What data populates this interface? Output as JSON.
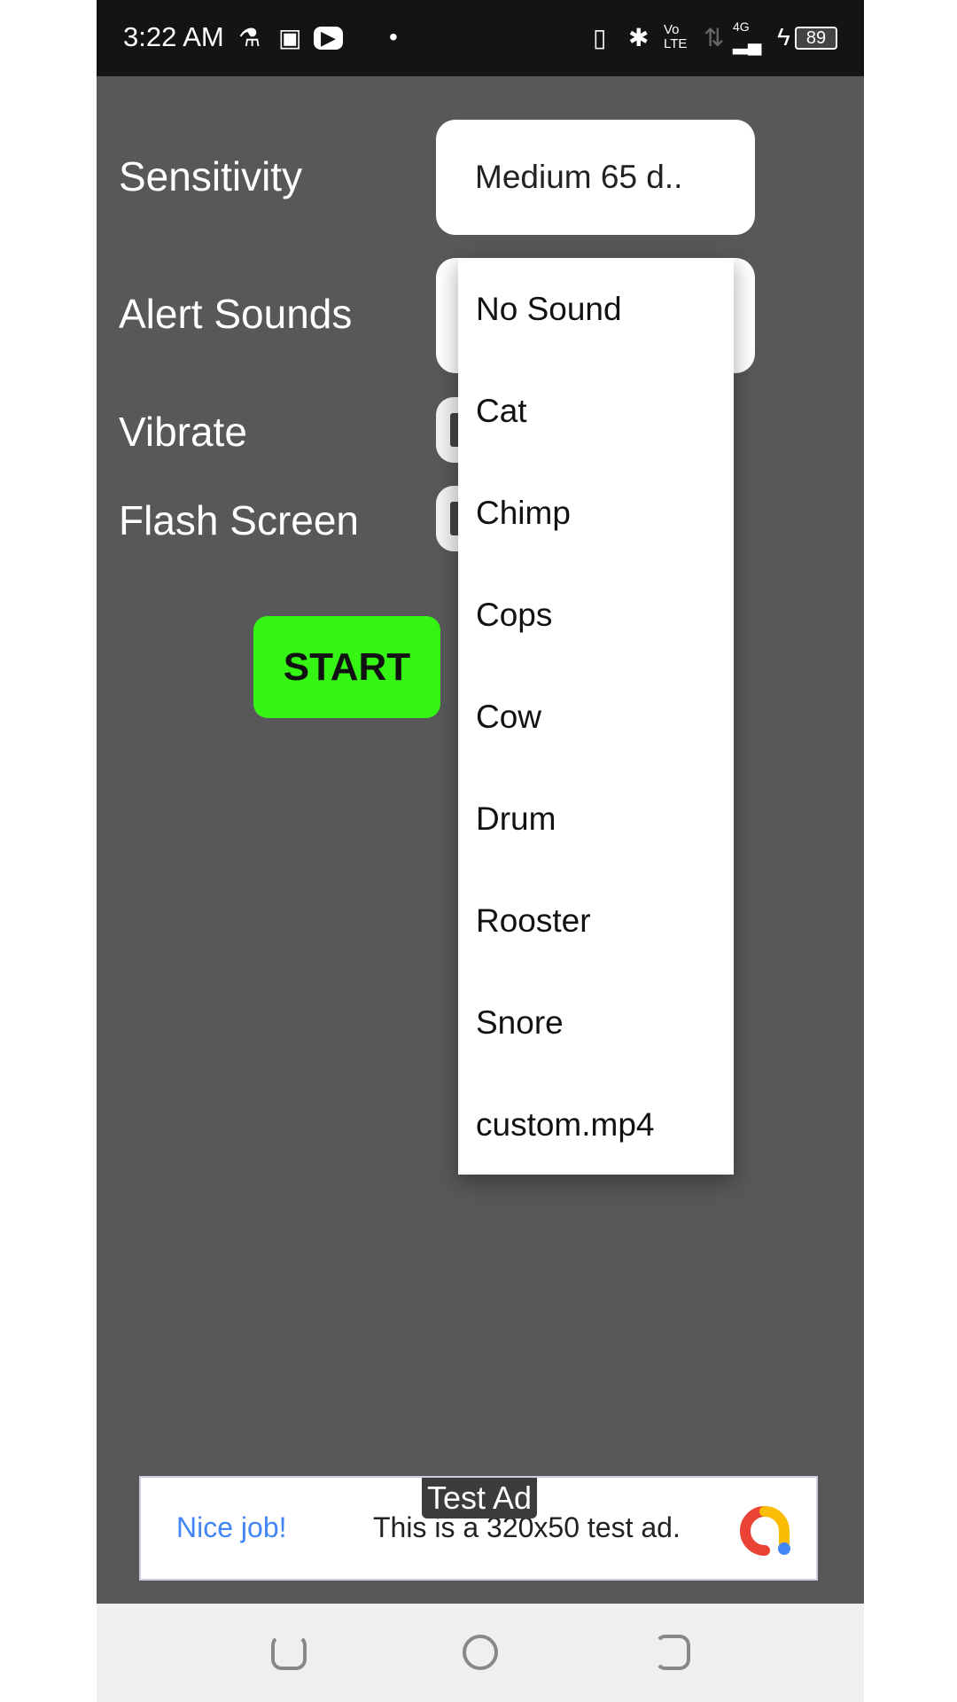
{
  "status_bar": {
    "time": "3:22 AM",
    "battery": "89",
    "network": "4G",
    "volte": "Vo LTE"
  },
  "settings": {
    "sensitivity": {
      "label": "Sensitivity",
      "value": "Medium  65 d.."
    },
    "alert_sounds": {
      "label": "Alert Sounds"
    },
    "vibrate": {
      "label": "Vibrate"
    },
    "flash_screen": {
      "label": "Flash Screen"
    },
    "start_label": "START",
    "start_color": "#35f515"
  },
  "dropdown": {
    "options": [
      "No Sound",
      "Cat",
      "Chimp",
      "Cops",
      "Cow",
      "Drum",
      "Rooster",
      "Snore",
      "custom.mp4"
    ]
  },
  "ad": {
    "tag": "Test Ad",
    "headline": "Nice job!",
    "message": "This is a 320x50 test ad."
  }
}
